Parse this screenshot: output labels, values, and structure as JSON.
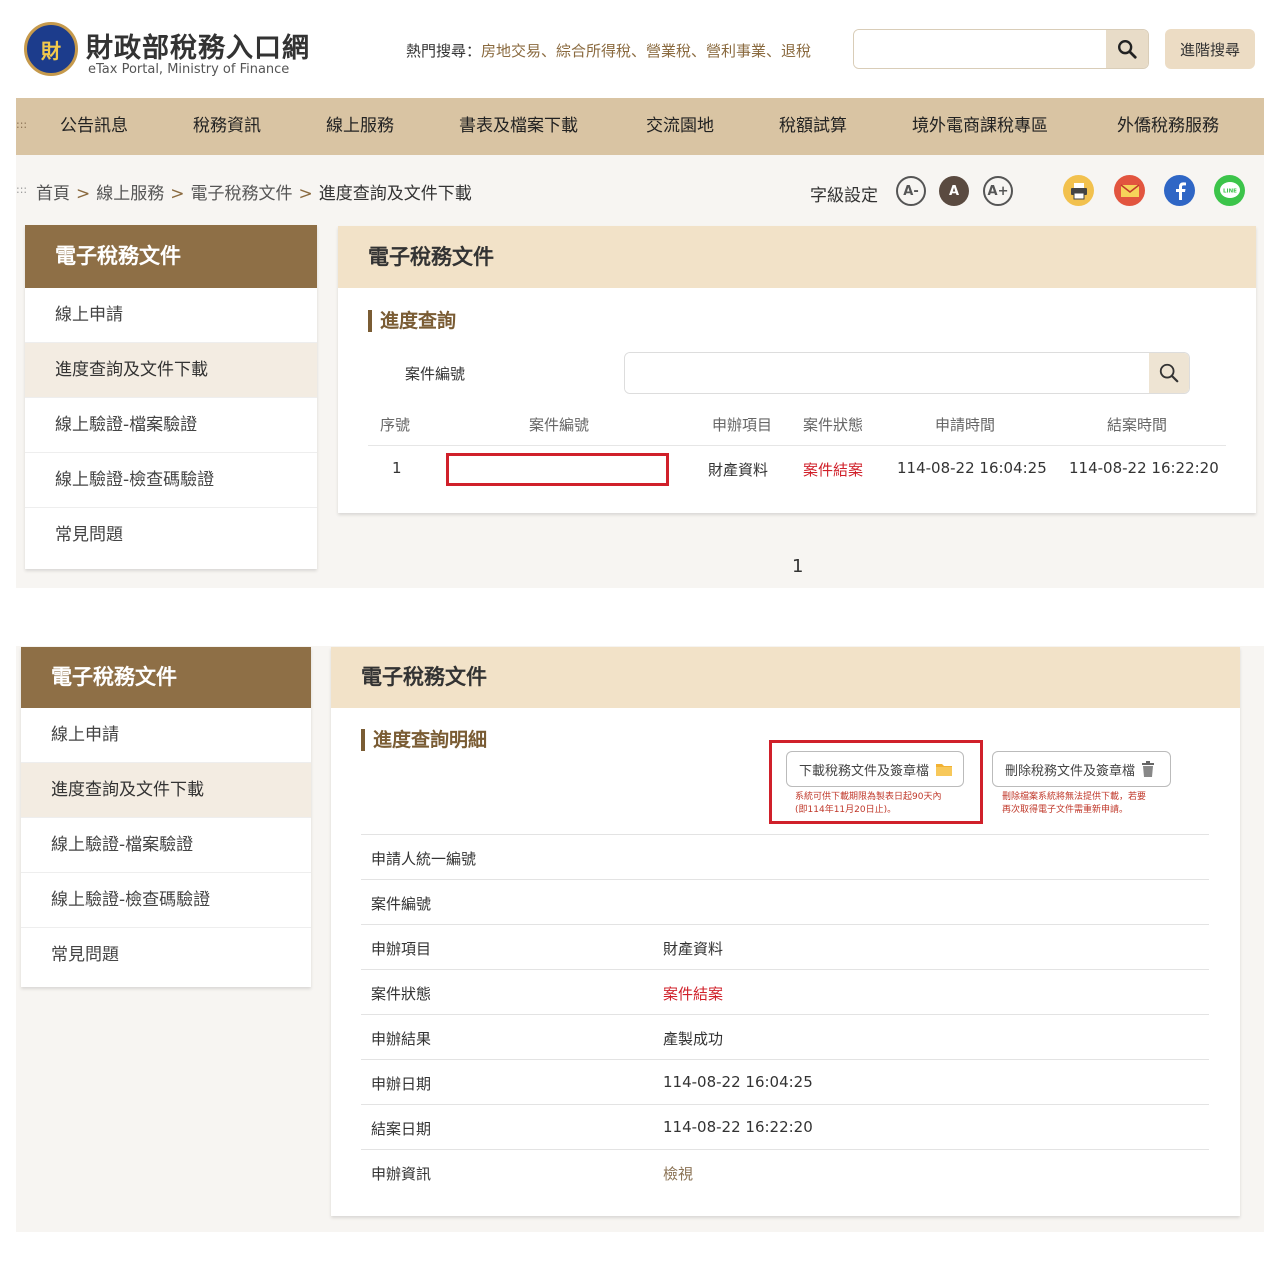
{
  "header": {
    "logo_seal_char": "財",
    "site_title": "財政部稅務入口網",
    "site_subtitle": "eTax Portal, Ministry of Finance",
    "hot_search_label": "熱門搜尋：",
    "hot_search_keywords": "房地交易、綜合所得稅、營業稅、營利事業、退稅",
    "search_placeholder": "",
    "advanced_search": "進階搜尋"
  },
  "nav": {
    "grip": ":::",
    "items": [
      "公告訊息",
      "稅務資訊",
      "線上服務",
      "書表及檔案下載",
      "交流園地",
      "稅額試算",
      "境外電商課稅專區",
      "外僑稅務服務"
    ]
  },
  "breadcrumb": {
    "grip": ":::",
    "items": [
      "首頁",
      "線上服務",
      "電子稅務文件",
      "進度查詢及文件下載"
    ],
    "separator": ">"
  },
  "font_settings": {
    "label": "字級設定",
    "smaller": "A-",
    "normal": "A",
    "larger": "A+"
  },
  "share": {
    "line_label": "LINE"
  },
  "sidebar": {
    "title": "電子稅務文件",
    "items": [
      "線上申請",
      "進度查詢及文件下載",
      "線上驗證-檔案驗證",
      "線上驗證-檢查碼驗證",
      "常見問題"
    ],
    "active_index": 1
  },
  "query": {
    "panel_title": "電子稅務文件",
    "section_title": "進度查詢",
    "case_label": "案件編號",
    "case_placeholder": "",
    "columns": [
      "序號",
      "案件編號",
      "申辦項目",
      "案件狀態",
      "申請時間",
      "結案時間"
    ],
    "rows": [
      {
        "no": "1",
        "case_no": "",
        "item": "財產資料",
        "status": "案件結案",
        "apply_time": "114-08-22 16:04:25",
        "close_time": "114-08-22 16:22:20"
      }
    ],
    "page": "1"
  },
  "detail": {
    "panel_title": "電子稅務文件",
    "section_title": "進度查詢明細",
    "download_button": "下載稅務文件及簽章檔",
    "download_note_line1": "系統可供下載期限為製表日起90天內",
    "download_note_line2": "(即114年11月20日止)。",
    "delete_button": "刪除稅務文件及簽章檔",
    "delete_note_line1": "刪除檔案系統將無法提供下載，若要",
    "delete_note_line2": "再次取得電子文件需重新申請。",
    "rows": [
      {
        "key": "申請人統一編號",
        "value": ""
      },
      {
        "key": "案件編號",
        "value": ""
      },
      {
        "key": "申辦項目",
        "value": "財產資料"
      },
      {
        "key": "案件狀態",
        "value": "案件結案"
      },
      {
        "key": "申辦結果",
        "value": "產製成功"
      },
      {
        "key": "申辦日期",
        "value": "114-08-22 16:04:25"
      },
      {
        "key": "結案日期",
        "value": "114-08-22 16:22:20"
      },
      {
        "key": "申辦資訊",
        "value": "檢視"
      }
    ]
  },
  "colors": {
    "brand_brown": "#8e6f46",
    "nav_tan": "#d9c4a3",
    "panel_head": "#f2e2c8",
    "status_red": "#d0202a"
  },
  "icons": [
    "search-icon",
    "print-icon",
    "mail-icon",
    "facebook-icon",
    "line-icon",
    "folder-icon",
    "trash-icon"
  ]
}
